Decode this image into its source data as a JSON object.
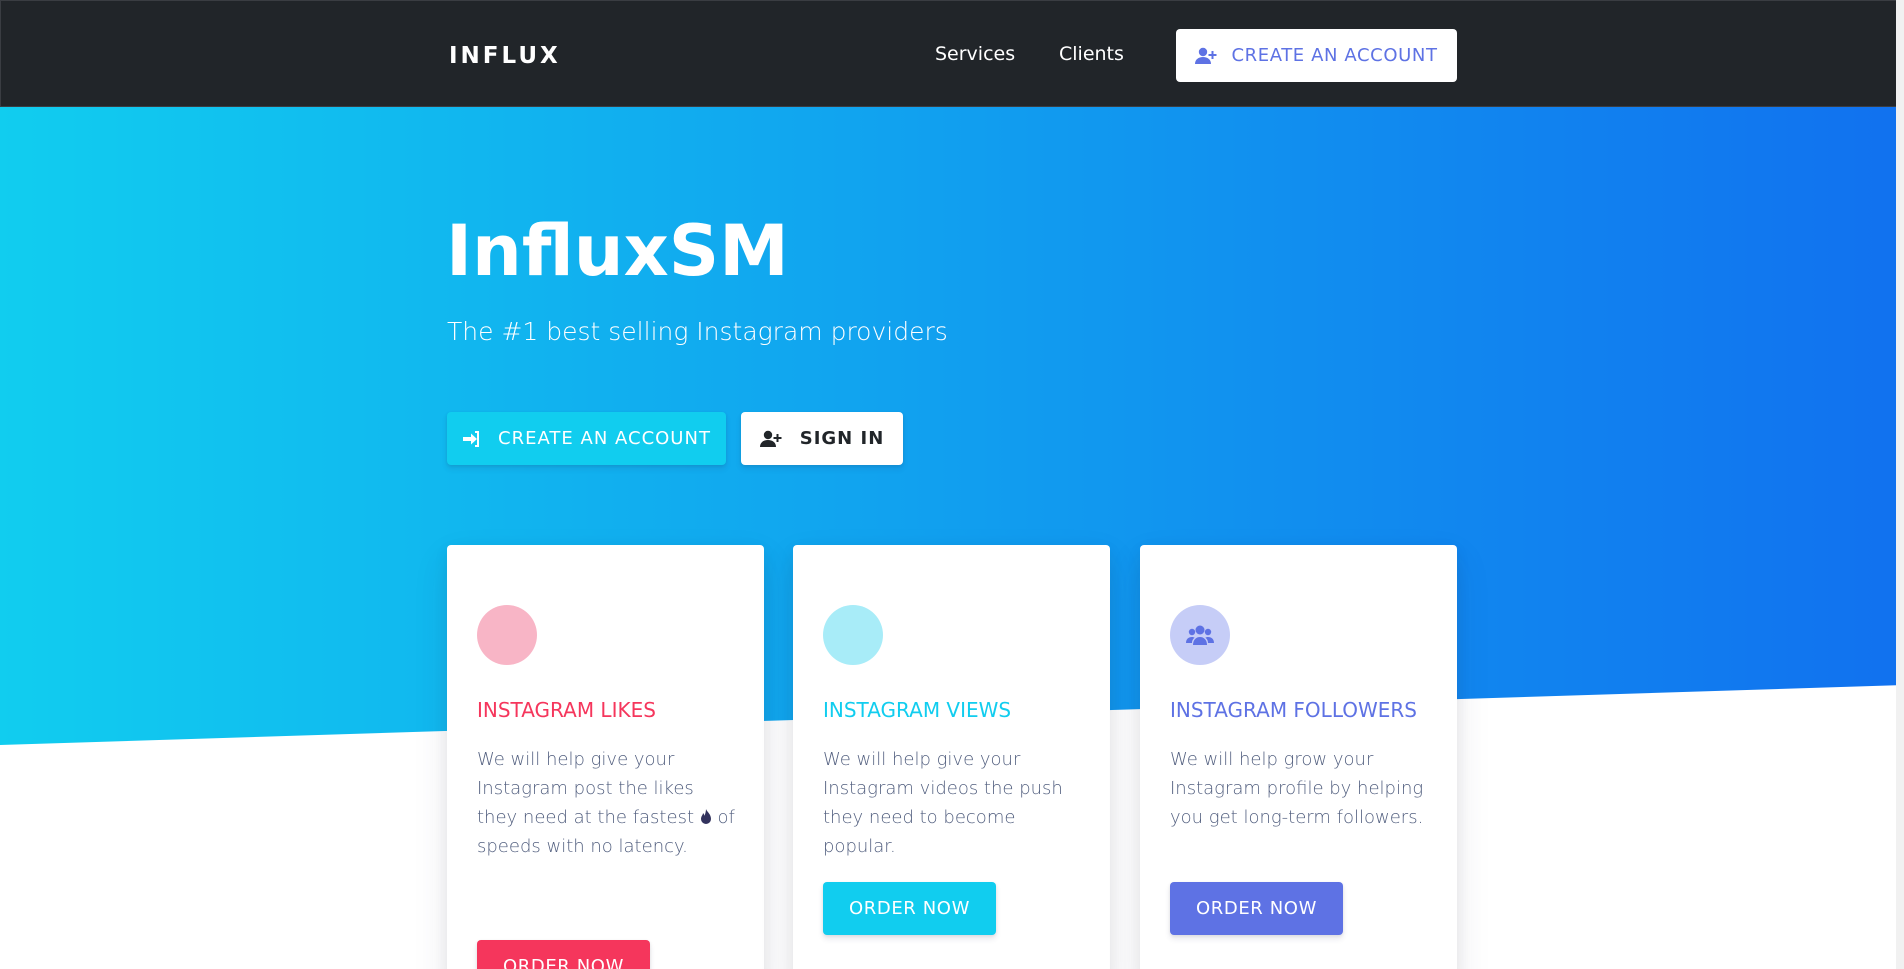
{
  "nav": {
    "brand": "INFLUX",
    "links": [
      "Services",
      "Clients"
    ],
    "cta_label": "CREATE AN ACCOUNT"
  },
  "hero": {
    "title": "InfluxSM",
    "subtitle": "The #1 best selling Instagram providers",
    "create_label": "CREATE AN ACCOUNT",
    "signin_label": "SIGN IN"
  },
  "cards": [
    {
      "title": "INSTAGRAM LIKES",
      "text_before": "We will help give your Instagram post the likes they need at the fastest",
      "text_after": "of speeds with no latency.",
      "button": "ORDER NOW",
      "icon": "heart-icon",
      "color": "#f5365c"
    },
    {
      "title": "INSTAGRAM VIEWS",
      "text": "We will help give your Instagram videos the push they need to become popular.",
      "button": "ORDER NOW",
      "icon": "eye-icon",
      "color": "#11cdef"
    },
    {
      "title": "INSTAGRAM FOLLOWERS",
      "text": "We will help grow your Instagram profile by helping you get long-term followers.",
      "button": "ORDER NOW",
      "icon": "users-icon",
      "color": "#5e72e4"
    }
  ],
  "colors": {
    "navbar": "#212529",
    "primary": "#5e72e4",
    "info": "#11cdef",
    "danger": "#f5365c"
  }
}
